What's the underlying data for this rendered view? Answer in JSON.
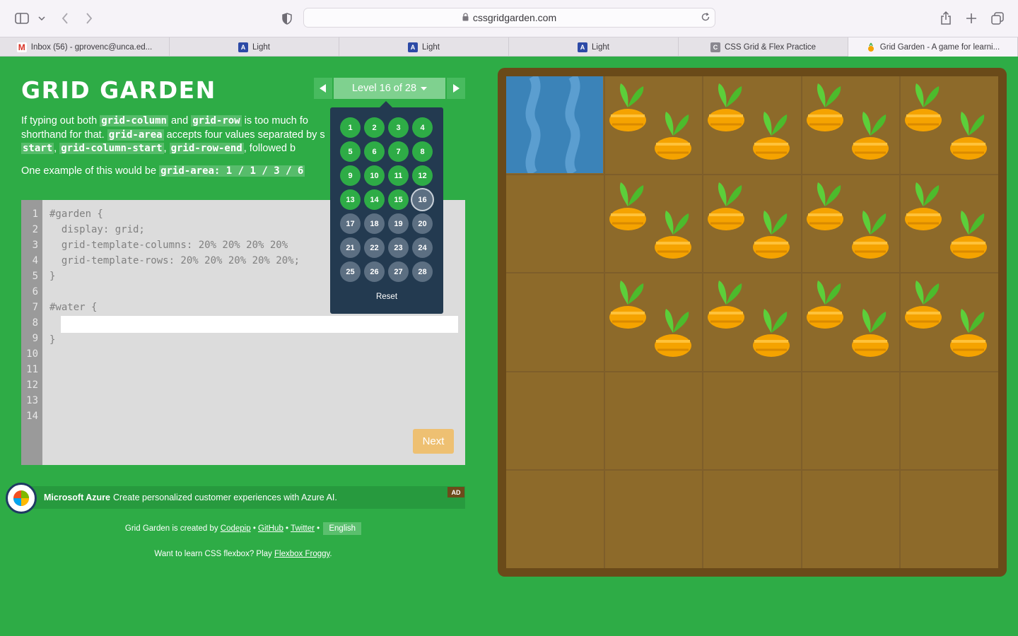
{
  "browser": {
    "url": "cssgridgarden.com",
    "tabs": [
      {
        "label": "Inbox (56) - gprovenc@unca.ed...",
        "icon": "gmail-icon",
        "active": false
      },
      {
        "label": "Light",
        "icon": "light-app-icon",
        "active": false
      },
      {
        "label": "Light",
        "icon": "light-app-icon",
        "active": false
      },
      {
        "label": "Light",
        "icon": "light-app-icon",
        "active": false
      },
      {
        "label": "CSS Grid & Flex Practice",
        "icon": "css-practice-icon",
        "active": false
      },
      {
        "label": "Grid Garden - A game for learni...",
        "icon": "carrot-icon",
        "active": true
      }
    ]
  },
  "game": {
    "title": "GRID GARDEN",
    "level_label": "Level 16 of 28",
    "current_level": 16,
    "completed_levels": 15,
    "levels": [
      "1",
      "2",
      "3",
      "4",
      "5",
      "6",
      "7",
      "8",
      "9",
      "10",
      "11",
      "12",
      "13",
      "14",
      "15",
      "16",
      "17",
      "18",
      "19",
      "20",
      "21",
      "22",
      "23",
      "24",
      "25",
      "26",
      "27",
      "28"
    ],
    "reset_label": "Reset",
    "instructions": {
      "p1_a": "If typing out both ",
      "p1_code1": "grid-column",
      "p1_b": " and ",
      "p1_code2": "grid-row",
      "p1_c": " is too much fo",
      "p1_d": "shorthand for that. ",
      "p1_code3": "grid-area",
      "p1_e": " accepts four values separated by s",
      "p1_code4": "start",
      "p1_f": ", ",
      "p1_code5": "grid-column-start",
      "p1_g": ", ",
      "p1_code6": "grid-row-end",
      "p1_h": ", followed b",
      "p2_a": "One example of this would be ",
      "p2_code": "grid-area: 1 / 1 / 3 / 6"
    },
    "editor": {
      "line_numbers": [
        "1",
        "2",
        "3",
        "4",
        "5",
        "6",
        "7",
        "8",
        "9",
        "10",
        "11",
        "12",
        "13",
        "14"
      ],
      "lines": [
        "#garden {",
        "  display: grid;",
        "  grid-template-columns: 20% 20% 20% 20%",
        "  grid-template-rows: 20% 20% 20% 20% 20%;",
        "}",
        "",
        "#water {",
        "",
        "}"
      ],
      "input_value": "",
      "next_label": "Next"
    }
  },
  "ad": {
    "brand": "Microsoft Azure",
    "text": "Create personalized customer experiences with Azure AI.",
    "badge": "AD"
  },
  "footer": {
    "created_by": "Grid Garden is created by ",
    "codepip": "Codepip",
    "sep": " • ",
    "github": "GitHub",
    "twitter": "Twitter",
    "language": "English",
    "flexbox_prompt": "Want to learn CSS flexbox? Play ",
    "flexbox_link": "Flexbox Froggy",
    "flexbox_end": "."
  },
  "garden": {
    "rows": 5,
    "cols": 5,
    "water_cell": [
      1,
      1
    ],
    "carrot_rows": 3,
    "carrot_cols_from": 2
  },
  "colors": {
    "background": "#2eac46",
    "water": "#3b83b8",
    "soil": "#8d6a2a",
    "carrot": "#f5a300",
    "leaf": "#5ccf3a"
  }
}
